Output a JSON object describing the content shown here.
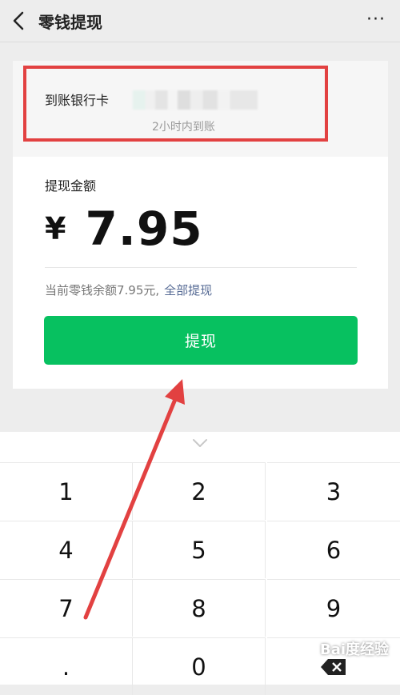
{
  "header": {
    "title": "零钱提现",
    "back_icon": "back-arrow-icon",
    "more_icon": "more-dots-icon",
    "more_glyph": "···"
  },
  "bank": {
    "label": "到账银行卡",
    "eta": "2小时内到账"
  },
  "amount": {
    "label": "提现金额",
    "currency": "¥",
    "value": "7.95"
  },
  "balance": {
    "text": "当前零钱余额7.95元,",
    "withdraw_all": "全部提现"
  },
  "button": {
    "label": "提现",
    "color": "#07c160"
  },
  "keypad": {
    "rows": [
      [
        "1",
        "2",
        "3"
      ],
      [
        "4",
        "5",
        "6"
      ],
      [
        "7",
        "8",
        "9"
      ],
      [
        ".",
        "0",
        "delete"
      ]
    ],
    "collapse_icon": "chevron-down-icon",
    "delete_icon": "backspace-icon"
  },
  "annotation": {
    "highlight_color": "#e24141",
    "arrow_color": "#e24141"
  },
  "watermark": {
    "text": "Bai度经验"
  }
}
